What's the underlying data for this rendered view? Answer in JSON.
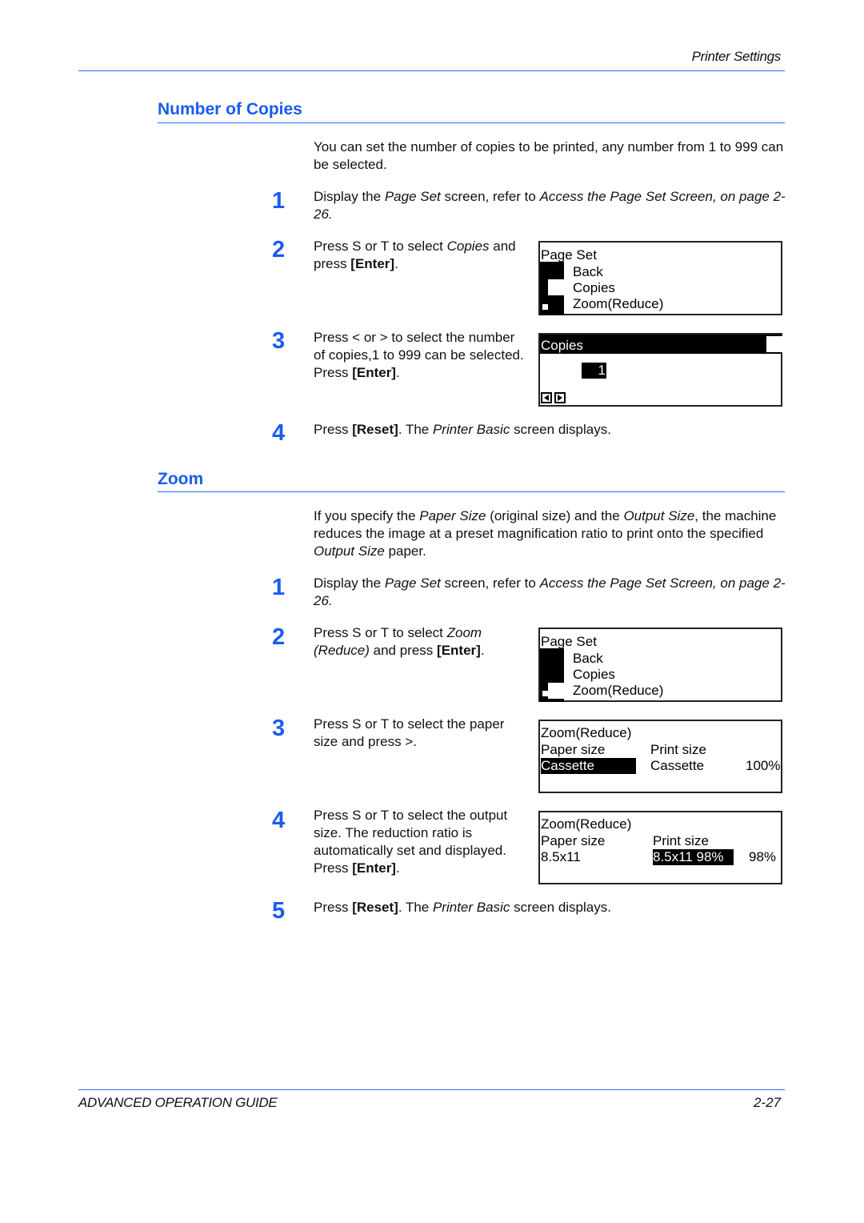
{
  "header": {
    "running_title": "Printer Settings"
  },
  "colors": {
    "accent": "#1a5cf0",
    "rule": "#2a6ff0"
  },
  "sections": [
    {
      "title": "Number of Copies",
      "intro": "You can set the number of copies to be printed, any number from 1 to 999 can be selected.",
      "steps": [
        {
          "num": "1",
          "parts": [
            "Display the ",
            "Page Set",
            " screen, refer to ",
            "Access the Page Set Screen, on page 2-26."
          ]
        },
        {
          "num": "2",
          "parts": [
            "Press  S or  T to select ",
            "Copies",
            " and press ",
            "[Enter]",
            "."
          ]
        },
        {
          "num": "3",
          "parts": [
            "Press < or > to select the number of copies,1 to 999 can be selected. Press ",
            "[Enter]",
            "."
          ]
        },
        {
          "num": "4",
          "parts": [
            "Press ",
            "[Reset]",
            ". The ",
            "Printer Basic",
            " screen displays."
          ]
        }
      ],
      "screens": [
        {
          "title": "Page Set",
          "items": [
            "Back",
            "Copies",
            "Zoom(Reduce)"
          ],
          "selected": "Copies"
        },
        {
          "title": "Copies",
          "value": "1",
          "icons": [
            "left-arrow-icon",
            "right-arrow-icon"
          ]
        }
      ]
    },
    {
      "title": "Zoom",
      "intro_parts": [
        "If you specify the ",
        "Paper Size",
        " (original size) and the ",
        "Output Size",
        ", the machine reduces the image at a preset magnification ratio to print onto the specified ",
        "Output Size",
        " paper."
      ],
      "steps": [
        {
          "num": "1",
          "parts": [
            "Display the ",
            "Page Set",
            " screen, refer to ",
            "Access the Page Set Screen, on page 2-26."
          ]
        },
        {
          "num": "2",
          "parts": [
            "Press  S or  T to select ",
            "Zoom (Reduce)",
            " and press ",
            "[Enter]",
            "."
          ]
        },
        {
          "num": "3",
          "parts": [
            "Press  S or  T to select the paper size and press >."
          ]
        },
        {
          "num": "4",
          "parts": [
            "Press  S or  T to select the output size. The reduction ratio is automatically set and displayed. Press ",
            "[Enter]",
            "."
          ]
        },
        {
          "num": "5",
          "parts": [
            "Press ",
            "[Reset]",
            ". The ",
            "Printer Basic",
            " screen displays."
          ]
        }
      ],
      "screens": [
        {
          "title": "Page Set",
          "items": [
            "Back",
            "Copies",
            "Zoom(Reduce)"
          ],
          "selected": "Zoom(Reduce)"
        },
        {
          "title": "Zoom(Reduce)",
          "col1_label": "Paper size",
          "col2_label": "Print size",
          "paper": "Cassette",
          "print": "Cassette",
          "ratio": "100%"
        },
        {
          "title": "Zoom(Reduce)",
          "col1_label": "Paper size",
          "col2_label": "Print size",
          "paper": "8.5x11",
          "print": "8.5x11 98%",
          "ratio": "98%"
        }
      ]
    }
  ],
  "footer": {
    "guide_title": "ADVANCED OPERATION GUIDE",
    "page_number": "2-27"
  }
}
